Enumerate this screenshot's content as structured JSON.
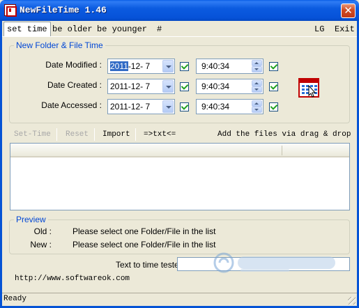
{
  "window": {
    "title": "NewFileTime 1.46",
    "close_symbol": "✕"
  },
  "menu": {
    "tabs": [
      {
        "label": "set time",
        "active": true
      },
      {
        "label": "be older"
      },
      {
        "label": "be younger"
      },
      {
        "label": "#"
      }
    ],
    "right": [
      "LG",
      "Exit"
    ]
  },
  "group_folder_file": {
    "title": "New Folder & File Time",
    "rows": [
      {
        "label": "Date Modified :",
        "date_selected": "2011",
        "date_rest": "-12-  7",
        "time": "9:40:34",
        "date_checked": true,
        "time_checked": true
      },
      {
        "label": "Date Created :",
        "date": "2011-12-  7",
        "time": "9:40:34",
        "date_checked": true,
        "time_checked": true
      },
      {
        "label": "Date Accessed :",
        "date": "2011-12-  7",
        "time": "9:40:34",
        "date_checked": true,
        "time_checked": true
      }
    ],
    "calendar_icon": "calendar-cursor-icon"
  },
  "toolbar": {
    "set_time": "Set-Time",
    "reset": "Reset",
    "import": "Import",
    "txt": "=>txt<=",
    "drag_drop": "Add the files via drag & drop ▾"
  },
  "preview": {
    "title": "Preview",
    "old_label": "Old :",
    "old_value": "Please select one Folder/File in the list",
    "new_label": "New :",
    "new_value": "Please select one Folder/File in the list"
  },
  "tester": {
    "label": "Text to time tester",
    "value": ""
  },
  "website": "http://www.softwareok.com",
  "status": "Ready",
  "colors": {
    "accent": "#0046d5",
    "titlebar": "#0553d5",
    "check": "#21a121"
  }
}
